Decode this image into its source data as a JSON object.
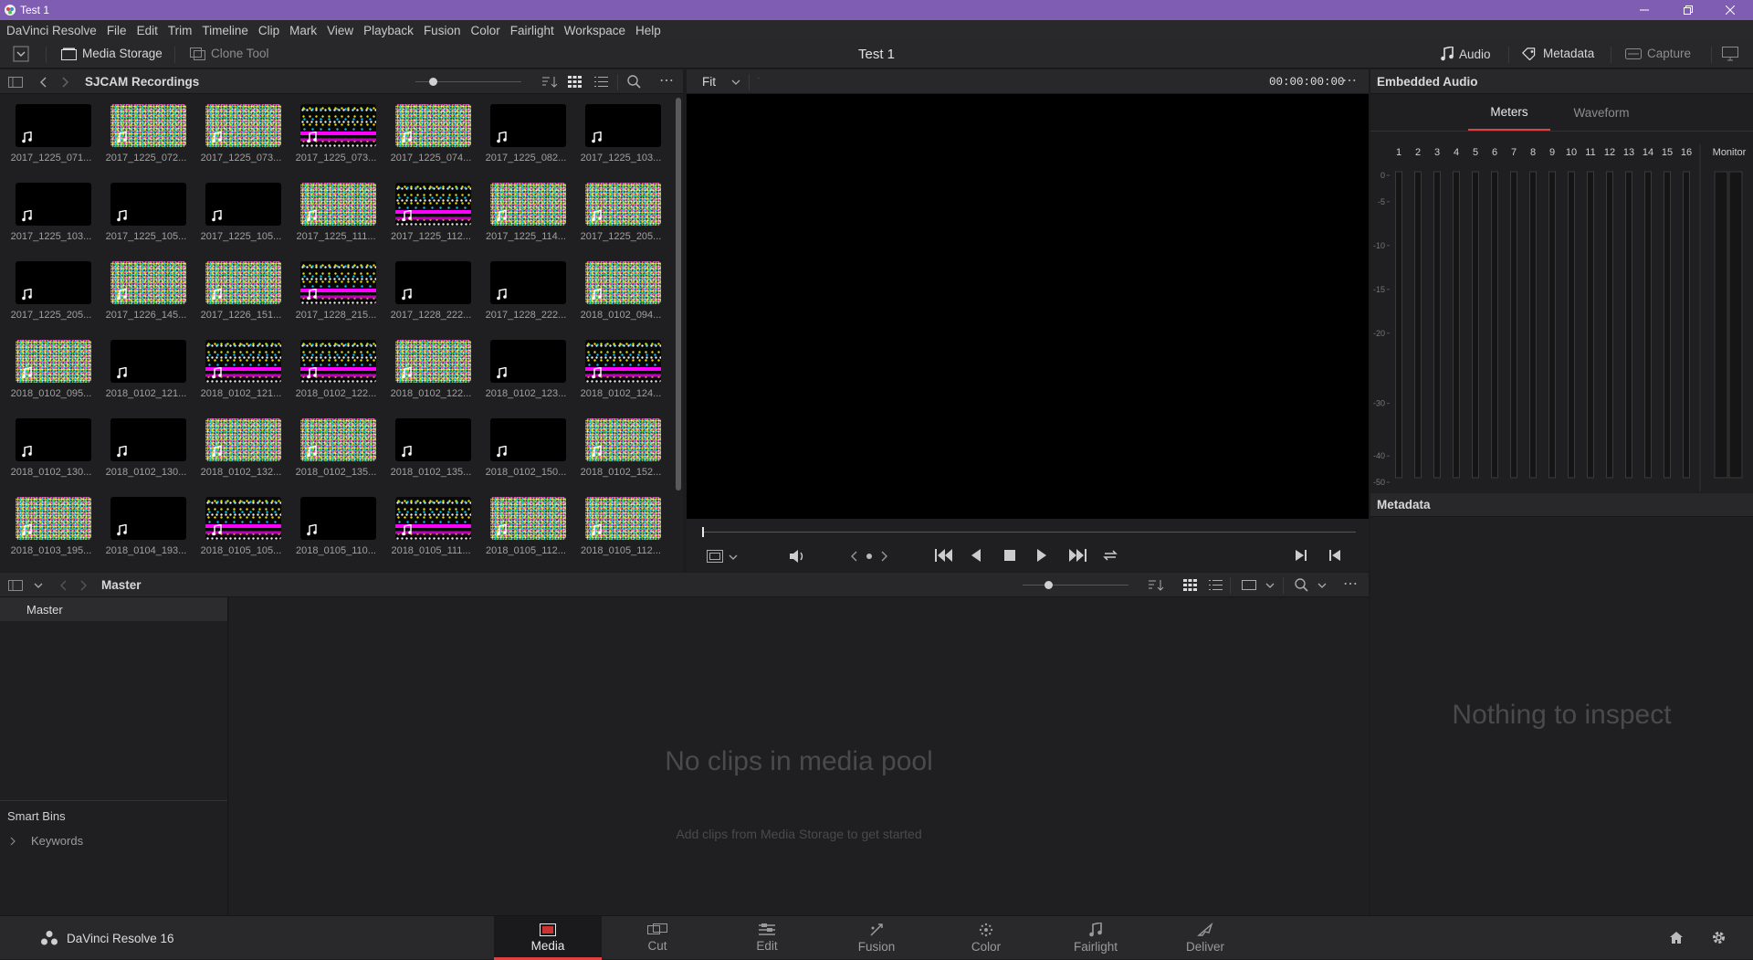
{
  "window": {
    "title": "Test 1"
  },
  "menu": [
    "DaVinci Resolve",
    "File",
    "Edit",
    "Trim",
    "Timeline",
    "Clip",
    "Mark",
    "View",
    "Playback",
    "Fusion",
    "Color",
    "Fairlight",
    "Workspace",
    "Help"
  ],
  "toolbar": {
    "media_storage": "Media Storage",
    "clone_tool": "Clone Tool",
    "project_title": "Test 1",
    "audio": "Audio",
    "metadata": "Metadata",
    "capture": "Capture"
  },
  "media_storage": {
    "folder": "SJCAM Recordings",
    "clips": [
      {
        "name": "2017_1225_071...",
        "thumb": "black"
      },
      {
        "name": "2017_1225_072...",
        "thumb": "noise"
      },
      {
        "name": "2017_1225_073...",
        "thumb": "noise"
      },
      {
        "name": "2017_1225_073...",
        "thumb": "stripe"
      },
      {
        "name": "2017_1225_074...",
        "thumb": "noise"
      },
      {
        "name": "2017_1225_082...",
        "thumb": "black"
      },
      {
        "name": "2017_1225_103...",
        "thumb": "black"
      },
      {
        "name": "2017_1225_103...",
        "thumb": "black"
      },
      {
        "name": "2017_1225_105...",
        "thumb": "black"
      },
      {
        "name": "2017_1225_105...",
        "thumb": "black"
      },
      {
        "name": "2017_1225_111...",
        "thumb": "noise"
      },
      {
        "name": "2017_1225_112...",
        "thumb": "stripe"
      },
      {
        "name": "2017_1225_114...",
        "thumb": "noise"
      },
      {
        "name": "2017_1225_205...",
        "thumb": "noise"
      },
      {
        "name": "2017_1225_205...",
        "thumb": "black"
      },
      {
        "name": "2017_1226_145...",
        "thumb": "noise"
      },
      {
        "name": "2017_1226_151...",
        "thumb": "noise"
      },
      {
        "name": "2017_1228_215...",
        "thumb": "stripe"
      },
      {
        "name": "2017_1228_222...",
        "thumb": "black"
      },
      {
        "name": "2017_1228_222...",
        "thumb": "black"
      },
      {
        "name": "2018_0102_094...",
        "thumb": "noise"
      },
      {
        "name": "2018_0102_095...",
        "thumb": "noise"
      },
      {
        "name": "2018_0102_121...",
        "thumb": "black"
      },
      {
        "name": "2018_0102_121...",
        "thumb": "stripe"
      },
      {
        "name": "2018_0102_122...",
        "thumb": "stripe"
      },
      {
        "name": "2018_0102_122...",
        "thumb": "noise"
      },
      {
        "name": "2018_0102_123...",
        "thumb": "black"
      },
      {
        "name": "2018_0102_124...",
        "thumb": "stripe"
      },
      {
        "name": "2018_0102_130...",
        "thumb": "black"
      },
      {
        "name": "2018_0102_130...",
        "thumb": "black"
      },
      {
        "name": "2018_0102_132...",
        "thumb": "noise"
      },
      {
        "name": "2018_0102_135...",
        "thumb": "noise"
      },
      {
        "name": "2018_0102_135...",
        "thumb": "black"
      },
      {
        "name": "2018_0102_150...",
        "thumb": "black"
      },
      {
        "name": "2018_0102_152...",
        "thumb": "noise"
      },
      {
        "name": "2018_0103_195...",
        "thumb": "noise"
      },
      {
        "name": "2018_0104_193...",
        "thumb": "black"
      },
      {
        "name": "2018_0105_105...",
        "thumb": "stripe"
      },
      {
        "name": "2018_0105_110...",
        "thumb": "black"
      },
      {
        "name": "2018_0105_111...",
        "thumb": "stripe"
      },
      {
        "name": "2018_0105_112...",
        "thumb": "noise"
      },
      {
        "name": "2018_0105_112...",
        "thumb": "noise"
      }
    ]
  },
  "viewer": {
    "zoom": "Fit",
    "timecode": "00:00:00:00"
  },
  "audio_panel": {
    "title": "Embedded Audio",
    "tabs": [
      "Meters",
      "Waveform"
    ],
    "active_tab": "Meters",
    "channels": [
      "1",
      "2",
      "3",
      "4",
      "5",
      "6",
      "7",
      "8",
      "9",
      "10",
      "11",
      "12",
      "13",
      "14",
      "15",
      "16"
    ],
    "monitor": "Monitor",
    "scale": [
      "0",
      "-5",
      "-10",
      "-15",
      "-20",
      "-30",
      "-40",
      "-50"
    ]
  },
  "metadata_panel": {
    "title": "Metadata",
    "empty": "Nothing to inspect"
  },
  "media_pool": {
    "bin_title": "Master",
    "bins": [
      "Master"
    ],
    "smart_bins": "Smart Bins",
    "keywords": "Keywords",
    "empty_title": "No clips in media pool",
    "empty_sub": "Add clips from Media Storage to get started"
  },
  "footer": {
    "app": "DaVinci Resolve 16"
  },
  "pages": [
    {
      "label": "Media",
      "icon": "media-page-icon",
      "active": true
    },
    {
      "label": "Cut",
      "icon": "cut-page-icon",
      "active": false
    },
    {
      "label": "Edit",
      "icon": "edit-page-icon",
      "active": false
    },
    {
      "label": "Fusion",
      "icon": "fusion-page-icon",
      "active": false
    },
    {
      "label": "Color",
      "icon": "color-page-icon",
      "active": false
    },
    {
      "label": "Fairlight",
      "icon": "fairlight-page-icon",
      "active": false
    },
    {
      "label": "Deliver",
      "icon": "deliver-page-icon",
      "active": false
    }
  ],
  "colors": {
    "titlebar": "#7e5db2",
    "accent": "#e04040",
    "noise_magenta": "#ff00ff"
  }
}
